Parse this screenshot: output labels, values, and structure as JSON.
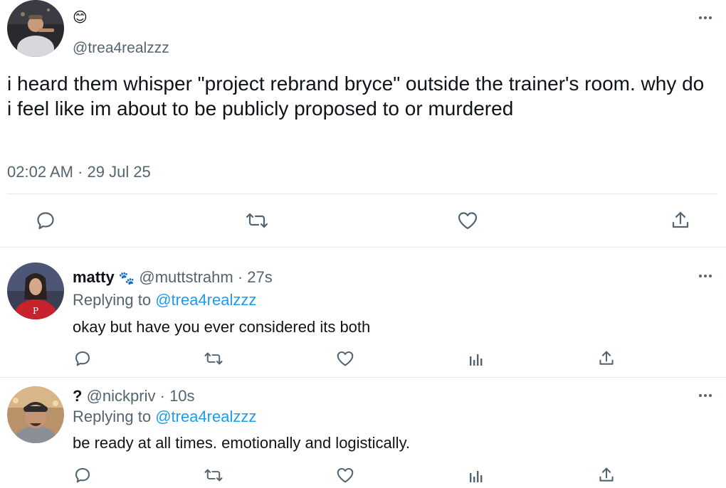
{
  "main_tweet": {
    "display_name": "😊",
    "handle": "@trea4realzzz",
    "text": "i heard them whisper \"project rebrand bryce\" outside the trainer's room. why do i feel like im about to be publicly proposed to or murdered",
    "timestamp": "02:02 AM · 29 Jul 25",
    "actions": [
      "reply-icon",
      "retweet-icon",
      "like-icon",
      "share-icon"
    ]
  },
  "replies": [
    {
      "display_name": "matty",
      "badge": "🐾",
      "handle": "@muttstrahm",
      "separator": "·",
      "time": "27s",
      "replying_label": "Replying to",
      "replying_to": "@trea4realzzz",
      "text": "okay but have you ever considered its both"
    },
    {
      "display_name": "?",
      "badge": "",
      "handle": "@nickpriv",
      "separator": "·",
      "time": "10s",
      "replying_label": "Replying to",
      "replying_to": "@trea4realzzz",
      "text": "be ready at all times. emotionally and logistically."
    }
  ],
  "colors": {
    "text": "#0f1419",
    "muted": "#536471",
    "link": "#1d9bf0",
    "divider": "#e6e9eb"
  }
}
